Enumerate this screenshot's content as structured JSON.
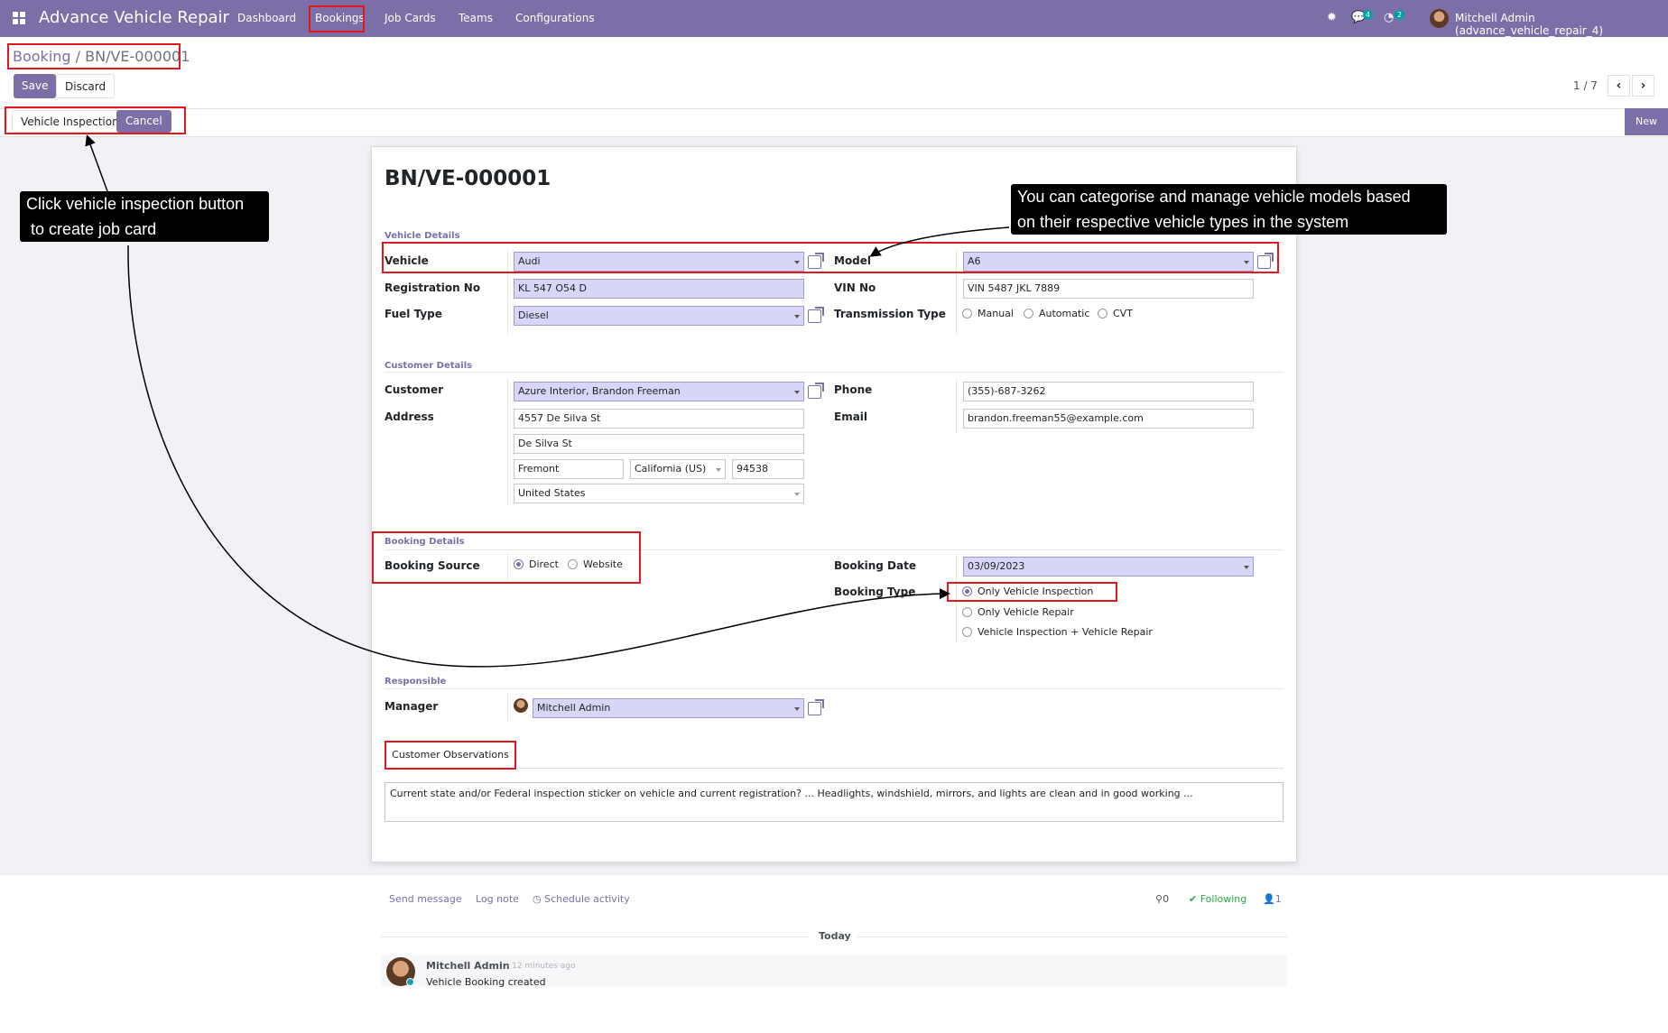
{
  "app": {
    "title": "Advance Vehicle Repair"
  },
  "nav": {
    "menu": [
      "Dashboard",
      "Bookings",
      "Job Cards",
      "Teams",
      "Configurations"
    ],
    "chat_count": "4",
    "activity_count": "2",
    "user": "Mitchell Admin (advance_vehicle_repair_4)"
  },
  "breadcrumb": {
    "parent": "Booking",
    "current": "BN/VE-000001"
  },
  "buttons": {
    "save": "Save",
    "discard": "Discard",
    "vehicle_inspection": "Vehicle Inspection",
    "cancel": "Cancel",
    "new": "New"
  },
  "pager": {
    "text": "1 / 7"
  },
  "record": {
    "name": "BN/VE-000001"
  },
  "vehicle": {
    "section": "Vehicle Details",
    "vehicle_label": "Vehicle",
    "vehicle": "Audi",
    "model_label": "Model",
    "model": "A6",
    "reg_label": "Registration No",
    "reg": "KL 547 O54 D",
    "vin_label": "VIN No",
    "vin": "VIN 5487 JKL 7889",
    "fuel_label": "Fuel Type",
    "fuel": "Diesel",
    "trans_label": "Transmission Type",
    "trans_options": [
      "Manual",
      "Automatic",
      "CVT"
    ]
  },
  "customer": {
    "section": "Customer Details",
    "customer_label": "Customer",
    "customer": "Azure Interior, Brandon Freeman",
    "address_label": "Address",
    "street": "4557 De Silva St",
    "street2": "De Silva St",
    "city": "Fremont",
    "state": "California (US)",
    "zip": "94538",
    "country": "United States",
    "phone_label": "Phone",
    "phone": "(355)-687-3262",
    "email_label": "Email",
    "email": "brandon.freeman55@example.com"
  },
  "booking": {
    "section": "Booking Details",
    "source_label": "Booking Source",
    "source_options": [
      "Direct",
      "Website"
    ],
    "date_label": "Booking Date",
    "date": "03/09/2023",
    "type_label": "Booking Type",
    "type_options": [
      "Only Vehicle Inspection",
      "Only Vehicle Repair",
      "Vehicle Inspection + Vehicle Repair"
    ]
  },
  "responsible": {
    "section": "Responsible",
    "manager_label": "Manager",
    "manager": "Mitchell Admin"
  },
  "observations": {
    "tab": "Customer Observations",
    "text": "Current state and/or Federal inspection sticker on vehicle and current registration? ... Headlights, windshield, mirrors, and lights are clean and in good working ..."
  },
  "chatter": {
    "send": "Send message",
    "log": "Log note",
    "schedule": "Schedule activity",
    "attachments": "0",
    "following": "Following",
    "followers": "1",
    "today": "Today",
    "author": "Mitchell Admin",
    "time": "- 12 minutes ago",
    "body": "Vehicle Booking created"
  },
  "annotations": {
    "tip1_line1": "Click vehicle inspection button",
    "tip1_line2": "to create job card",
    "tip2_line1": "You can categorise and manage vehicle models based",
    "tip2_line2": "on their respective vehicle types in the system"
  }
}
